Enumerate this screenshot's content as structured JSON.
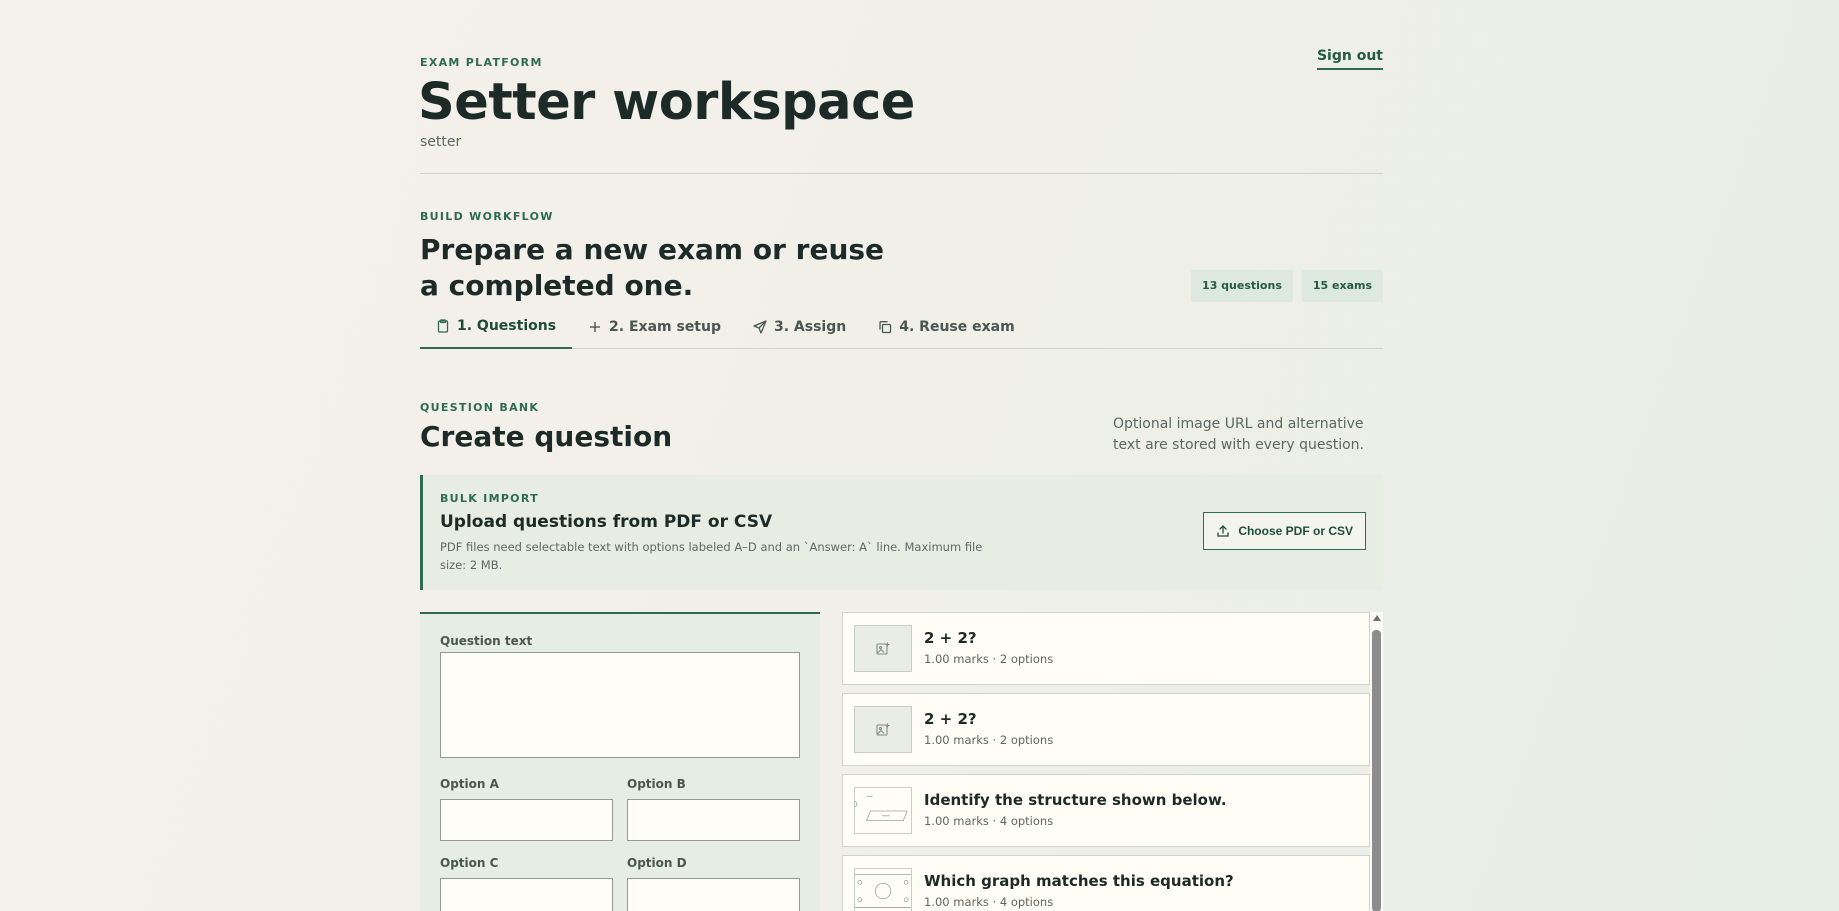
{
  "header": {
    "eyebrow": "EXAM PLATFORM",
    "title": "Setter workspace",
    "role": "setter",
    "sign_out": "Sign out"
  },
  "workflow": {
    "eyebrow": "BUILD WORKFLOW",
    "title": "Prepare a new exam or reuse a completed one.",
    "chips": [
      "13 questions",
      "15 exams"
    ],
    "tabs": [
      {
        "label": "1. Questions",
        "icon": "clipboard-icon",
        "active": true
      },
      {
        "label": "2. Exam setup",
        "icon": "plus-icon",
        "active": false
      },
      {
        "label": "3. Assign",
        "icon": "send-icon",
        "active": false
      },
      {
        "label": "4. Reuse exam",
        "icon": "copy-icon",
        "active": false
      }
    ]
  },
  "question_bank": {
    "eyebrow": "QUESTION BANK",
    "title": "Create question",
    "note": "Optional image URL and alternative text are stored with every question."
  },
  "bulk_import": {
    "eyebrow": "BULK IMPORT",
    "title": "Upload questions from PDF or CSV",
    "description": "PDF files need selectable text with options labeled A–D and an `Answer: A` line. Maximum file size: 2 MB.",
    "button": "Choose PDF or CSV",
    "button_icon": "upload-icon"
  },
  "form": {
    "question_text_label": "Question text",
    "option_a_label": "Option A",
    "option_b_label": "Option B",
    "option_c_label": "Option C",
    "option_d_label": "Option D",
    "question_text_value": "",
    "option_a_value": "",
    "option_b_value": "",
    "option_c_value": "",
    "option_d_value": ""
  },
  "questions": [
    {
      "title": "2 + 2?",
      "meta": "1.00 marks · 2 options",
      "thumb": "image-placeholder-icon"
    },
    {
      "title": "2 + 2?",
      "meta": "1.00 marks · 2 options",
      "thumb": "image-placeholder-icon"
    },
    {
      "title": "Identify the structure shown below.",
      "meta": "1.00 marks · 4 options",
      "thumb": "structure-diagram-thumbnail"
    },
    {
      "title": "Which graph matches this equation?",
      "meta": "1.00 marks · 4 options",
      "thumb": "graph-thumbnail"
    }
  ],
  "colors": {
    "accent": "#2f6b4f",
    "text": "#1c2a28",
    "muted": "#5d6762",
    "chip_bg": "#dde8e0",
    "panel_bg": "#e6ede4",
    "card_bg": "#fffdf6"
  }
}
